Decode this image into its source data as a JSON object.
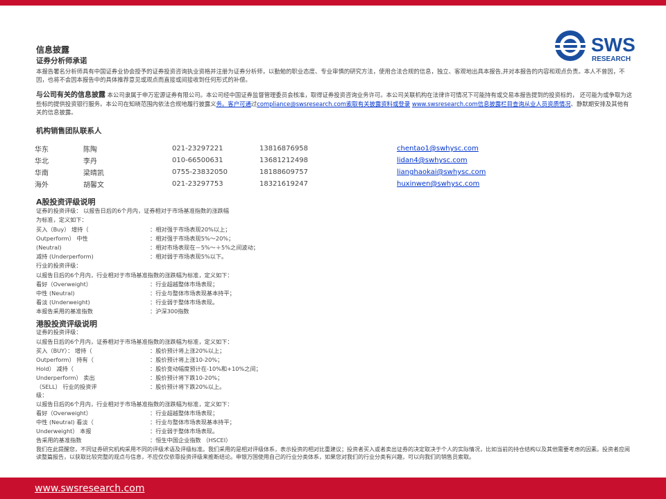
{
  "colors": {
    "brand_red": "#c8102e",
    "brand_blue": "#1a4fa0",
    "link_blue": "#0033cc"
  },
  "logo": {
    "text": "SWS",
    "subtext": "RESEARCH"
  },
  "disclosure": {
    "title": "信息披露",
    "analyst_title": "证券分析师承诺",
    "analyst_text": "本报告署名分析师具有中国证券业协会授予的证券投资咨询执业资格并注册为证券分析师，以勤勉的职业态度、专业审慎的研究方法，使用合法合规的信息，独立、客观地出具本报告,并对本报告的内容和观点负责。本人不曾因，不因，也将不会因本报告中的具体推荐意见或观点而直接或间接收到任何形式的补偿。",
    "company_title": "与公司有关的信息披露",
    "company_text_1": "本公司隶属于申万宏源证券有限公司。本公司经中国证券监督管理委员会核准，取得证券投资咨询业务许可。本公司关联机构在法律许可情况下可能持有或交易本报告提到的投资标的， 还可能为或争取为这些标的提供投资银行服务。本公司在知晓范围内依法合规地履行披露义",
    "company_link_1": "务。客户可通",
    "company_text_2": "过",
    "company_link_2": "compliance@swsresearch.com索取有关披露资料或登录",
    "company_text_3": " ",
    "company_link_3": "www.swsresearch.com信息披露栏目查询从业人员资质情况",
    "company_text_4": "、静默期安排及其他有关的信息披露。"
  },
  "contacts": {
    "title": "机构销售团队联系人",
    "rows": [
      {
        "region": "华东",
        "name": "陈陶",
        "phone": "021-23297221",
        "mobile": "13816876958",
        "email": "chentao1@swhysc.com"
      },
      {
        "region": "华北",
        "name": "李丹",
        "phone": "010-66500631",
        "mobile": "13681212498",
        "email": "lidan4@swhysc.com"
      },
      {
        "region": "华南",
        "name": "梁晴凯",
        "phone": "0755-23832050",
        "mobile": "18188609757",
        "email": "lianghaokai@swhysc.com"
      },
      {
        "region": "海外",
        "name": "胡馨文",
        "phone": "021-23297753",
        "mobile": "18321619247",
        "email": "huxinwen@swhysc.com"
      }
    ]
  },
  "a_rating": {
    "title": "A股投资评级说明",
    "intro_1": "证券的投资评级： 以报告日后的6个月内，证券相对于市场基准指数的涨跌幅",
    "intro_2": "为标准，定义如下：",
    "stock_rows": [
      {
        "label": "买入（Buy） 增持（",
        "desc": "：相对强于市场表现20%以上；"
      },
      {
        "label": "Outperform） 中性",
        "desc": "：相对强于市场表现5%～20%；"
      },
      {
        "label": "(Neutral)",
        "desc": "：相对市场表现在－5%～＋5%之间波动；"
      },
      {
        "label": "减持 (Underperform)",
        "desc": "：相对弱于市场表现5%以下。"
      }
    ],
    "industry_intro_1": "行业的投资评级：",
    "industry_intro_2": "以报告日后的6个月内，行业相对于市场基准指数的涨跌幅为标准，定义如下：",
    "industry_rows": [
      {
        "label": "看好（Overweight）",
        "desc": "：行业超越整体市场表现；"
      },
      {
        "label": "中性 (Neutral)",
        "desc": "：行业与整体市场表现基本持平；"
      },
      {
        "label": "看淡 (Underweight)",
        "desc": "：行业弱于整体市场表现。"
      },
      {
        "label": "本报告采用的基准指数",
        "desc": "：沪深300指数"
      }
    ]
  },
  "hk_rating": {
    "title": "港股投资评级说明",
    "intro_1": "证券的投资评级：",
    "intro_2": "以报告日后的6个月内，证券相对于市场基准指数的涨跌幅为标准，定义如下：",
    "stock_rows": [
      {
        "label": "买入（BUY）： 增持（",
        "desc": "：股价预计将上涨20%以上；"
      },
      {
        "label": "Outperform） 持有（",
        "desc": "：股价预计将上涨10-20%；"
      },
      {
        "label": "Hold） 减持（",
        "desc": "：股价变动幅度预计在-10%和+10%之间；"
      },
      {
        "label": "Underperform） 卖出",
        "desc": "：股价预计将下跌10-20%；"
      },
      {
        "label": "（SELL） 行业的投资评",
        "desc": "：股价预计将下跌20%以上。"
      }
    ],
    "industry_intro_1": "级：",
    "industry_intro_2": "以报告日后的6个月内，行业相对于市场基准指数的涨跌幅为标准，定义如下：",
    "industry_rows": [
      {
        "label": "看好（Overweight）",
        "desc": "：行业超越整体市场表现；"
      },
      {
        "label": "中性 (Neutral) 看淡（",
        "desc": "：行业与整体市场表现基本持平；"
      },
      {
        "label": "Underweight） 本报",
        "desc": "：行业弱于整体市场表现。"
      },
      {
        "label": "告采用的基准指数",
        "desc": "：恒生中国企业指数 （HSCEI）"
      }
    ]
  },
  "disclaimer": "我们在此提醒您，不同证券研究机构采用不同的评级术语及评级标准。我们采用的是相对评级体系，表示投资的相对比重建议；投资者买入或者卖出证券的决定取决于个人的实际情况，比如当前的持仓结构以及其他需要考虑的因素。投资者应阅读整篇报告，以获取比较完整的观点与信息，不应仅仅依靠投资评级来推断结论。申银万国使用自己的行业分类体系，如果您对我们的行业分类有兴趣，可以向我们的销售员索取。",
  "footer": {
    "url": "www.swsresearch.com"
  }
}
